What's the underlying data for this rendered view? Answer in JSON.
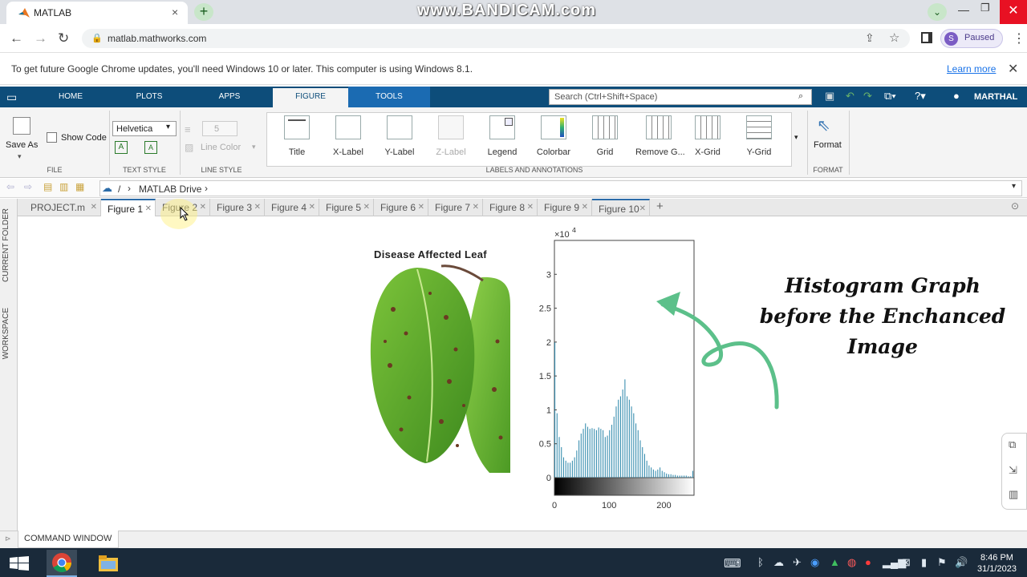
{
  "browser": {
    "tab_title": "MATLAB",
    "tab_close": "×",
    "new_tab": "+",
    "watermark": "www.BANDICAM.com",
    "url": "matlab.mathworks.com",
    "profile_initial": "S",
    "profile_status": "Paused"
  },
  "infobar": {
    "message": "To get future Google Chrome updates, you'll need Windows 10 or later. This computer is using Windows 8.1.",
    "learn_more": "Learn more"
  },
  "toolstrip": {
    "tabs": [
      "HOME",
      "PLOTS",
      "APPS",
      "FIGURE",
      "TOOLS"
    ],
    "search_placeholder": "Search (Ctrl+Shift+Space)",
    "user": "MARTHAL"
  },
  "ribbon": {
    "save_as": "Save As",
    "show_code": "Show Code",
    "font": "Helvetica",
    "line_width": "5",
    "line_color": "Line Color",
    "sections": [
      "FILE",
      "TEXT STYLE",
      "LINE STYLE",
      "LABELS AND ANNOTATIONS",
      "FORMAT"
    ],
    "buttons": [
      "Title",
      "X-Label",
      "Y-Label",
      "Z-Label",
      "Legend",
      "Colorbar",
      "Grid",
      "Remove G...",
      "X-Grid",
      "Y-Grid"
    ],
    "format": "Format"
  },
  "path": {
    "sep": "/",
    "folder": "MATLAB Drive"
  },
  "doc_tabs": [
    "PROJECT.m",
    "Figure 1",
    "Figure 2",
    "Figure 3",
    "Figure 4",
    "Figure 5",
    "Figure 6",
    "Figure 7",
    "Figure 8",
    "Figure 9",
    "Figure 10"
  ],
  "side_panels": [
    "CURRENT FOLDER",
    "WORKSPACE"
  ],
  "figure": {
    "image_title": "Disease Affected Leaf",
    "annotation_lines": [
      "Histogram Graph",
      "before  the Enchanced",
      "Image"
    ]
  },
  "command_window": "COMMAND WINDOW",
  "taskbar": {
    "time": "8:46 PM",
    "date": "31/1/2023"
  },
  "colors": {
    "matlab_blue": "#0d4d7a",
    "histogram_bar": "#3a8fb0",
    "arrow_green": "#5cc08a"
  },
  "chart_data": {
    "type": "bar",
    "title": "",
    "xlabel": "",
    "ylabel": "",
    "y_exponent_label": "×10",
    "y_exponent": "4",
    "xlim": [
      0,
      255
    ],
    "ylim": [
      0,
      3.5
    ],
    "xticks": [
      "0",
      "100",
      "200"
    ],
    "yticks": [
      "0",
      "0.5",
      "1",
      "1.5",
      "2",
      "2.5",
      "3"
    ],
    "colorbar": "grayscale 0-255",
    "x": [
      0,
      4,
      8,
      12,
      16,
      20,
      24,
      28,
      32,
      36,
      40,
      44,
      48,
      52,
      56,
      60,
      64,
      68,
      72,
      76,
      80,
      84,
      88,
      92,
      96,
      100,
      104,
      108,
      112,
      116,
      120,
      124,
      128,
      132,
      136,
      140,
      144,
      148,
      152,
      156,
      160,
      164,
      168,
      172,
      176,
      180,
      184,
      188,
      192,
      196,
      200,
      204,
      208,
      212,
      216,
      220,
      224,
      228,
      232,
      236,
      240,
      244,
      248,
      252
    ],
    "values": [
      2.0,
      0.95,
      0.6,
      0.45,
      0.3,
      0.25,
      0.22,
      0.22,
      0.25,
      0.3,
      0.4,
      0.55,
      0.65,
      0.72,
      0.8,
      0.75,
      0.72,
      0.73,
      0.72,
      0.7,
      0.74,
      0.72,
      0.7,
      0.6,
      0.62,
      0.7,
      0.78,
      0.9,
      1.05,
      1.15,
      1.2,
      1.3,
      1.45,
      1.2,
      1.15,
      1.05,
      0.95,
      0.8,
      0.7,
      0.55,
      0.45,
      0.35,
      0.25,
      0.18,
      0.15,
      0.12,
      0.1,
      0.12,
      0.15,
      0.1,
      0.08,
      0.06,
      0.05,
      0.05,
      0.04,
      0.04,
      0.03,
      0.03,
      0.03,
      0.03,
      0.03,
      0.02,
      0.02,
      0.1
    ]
  }
}
